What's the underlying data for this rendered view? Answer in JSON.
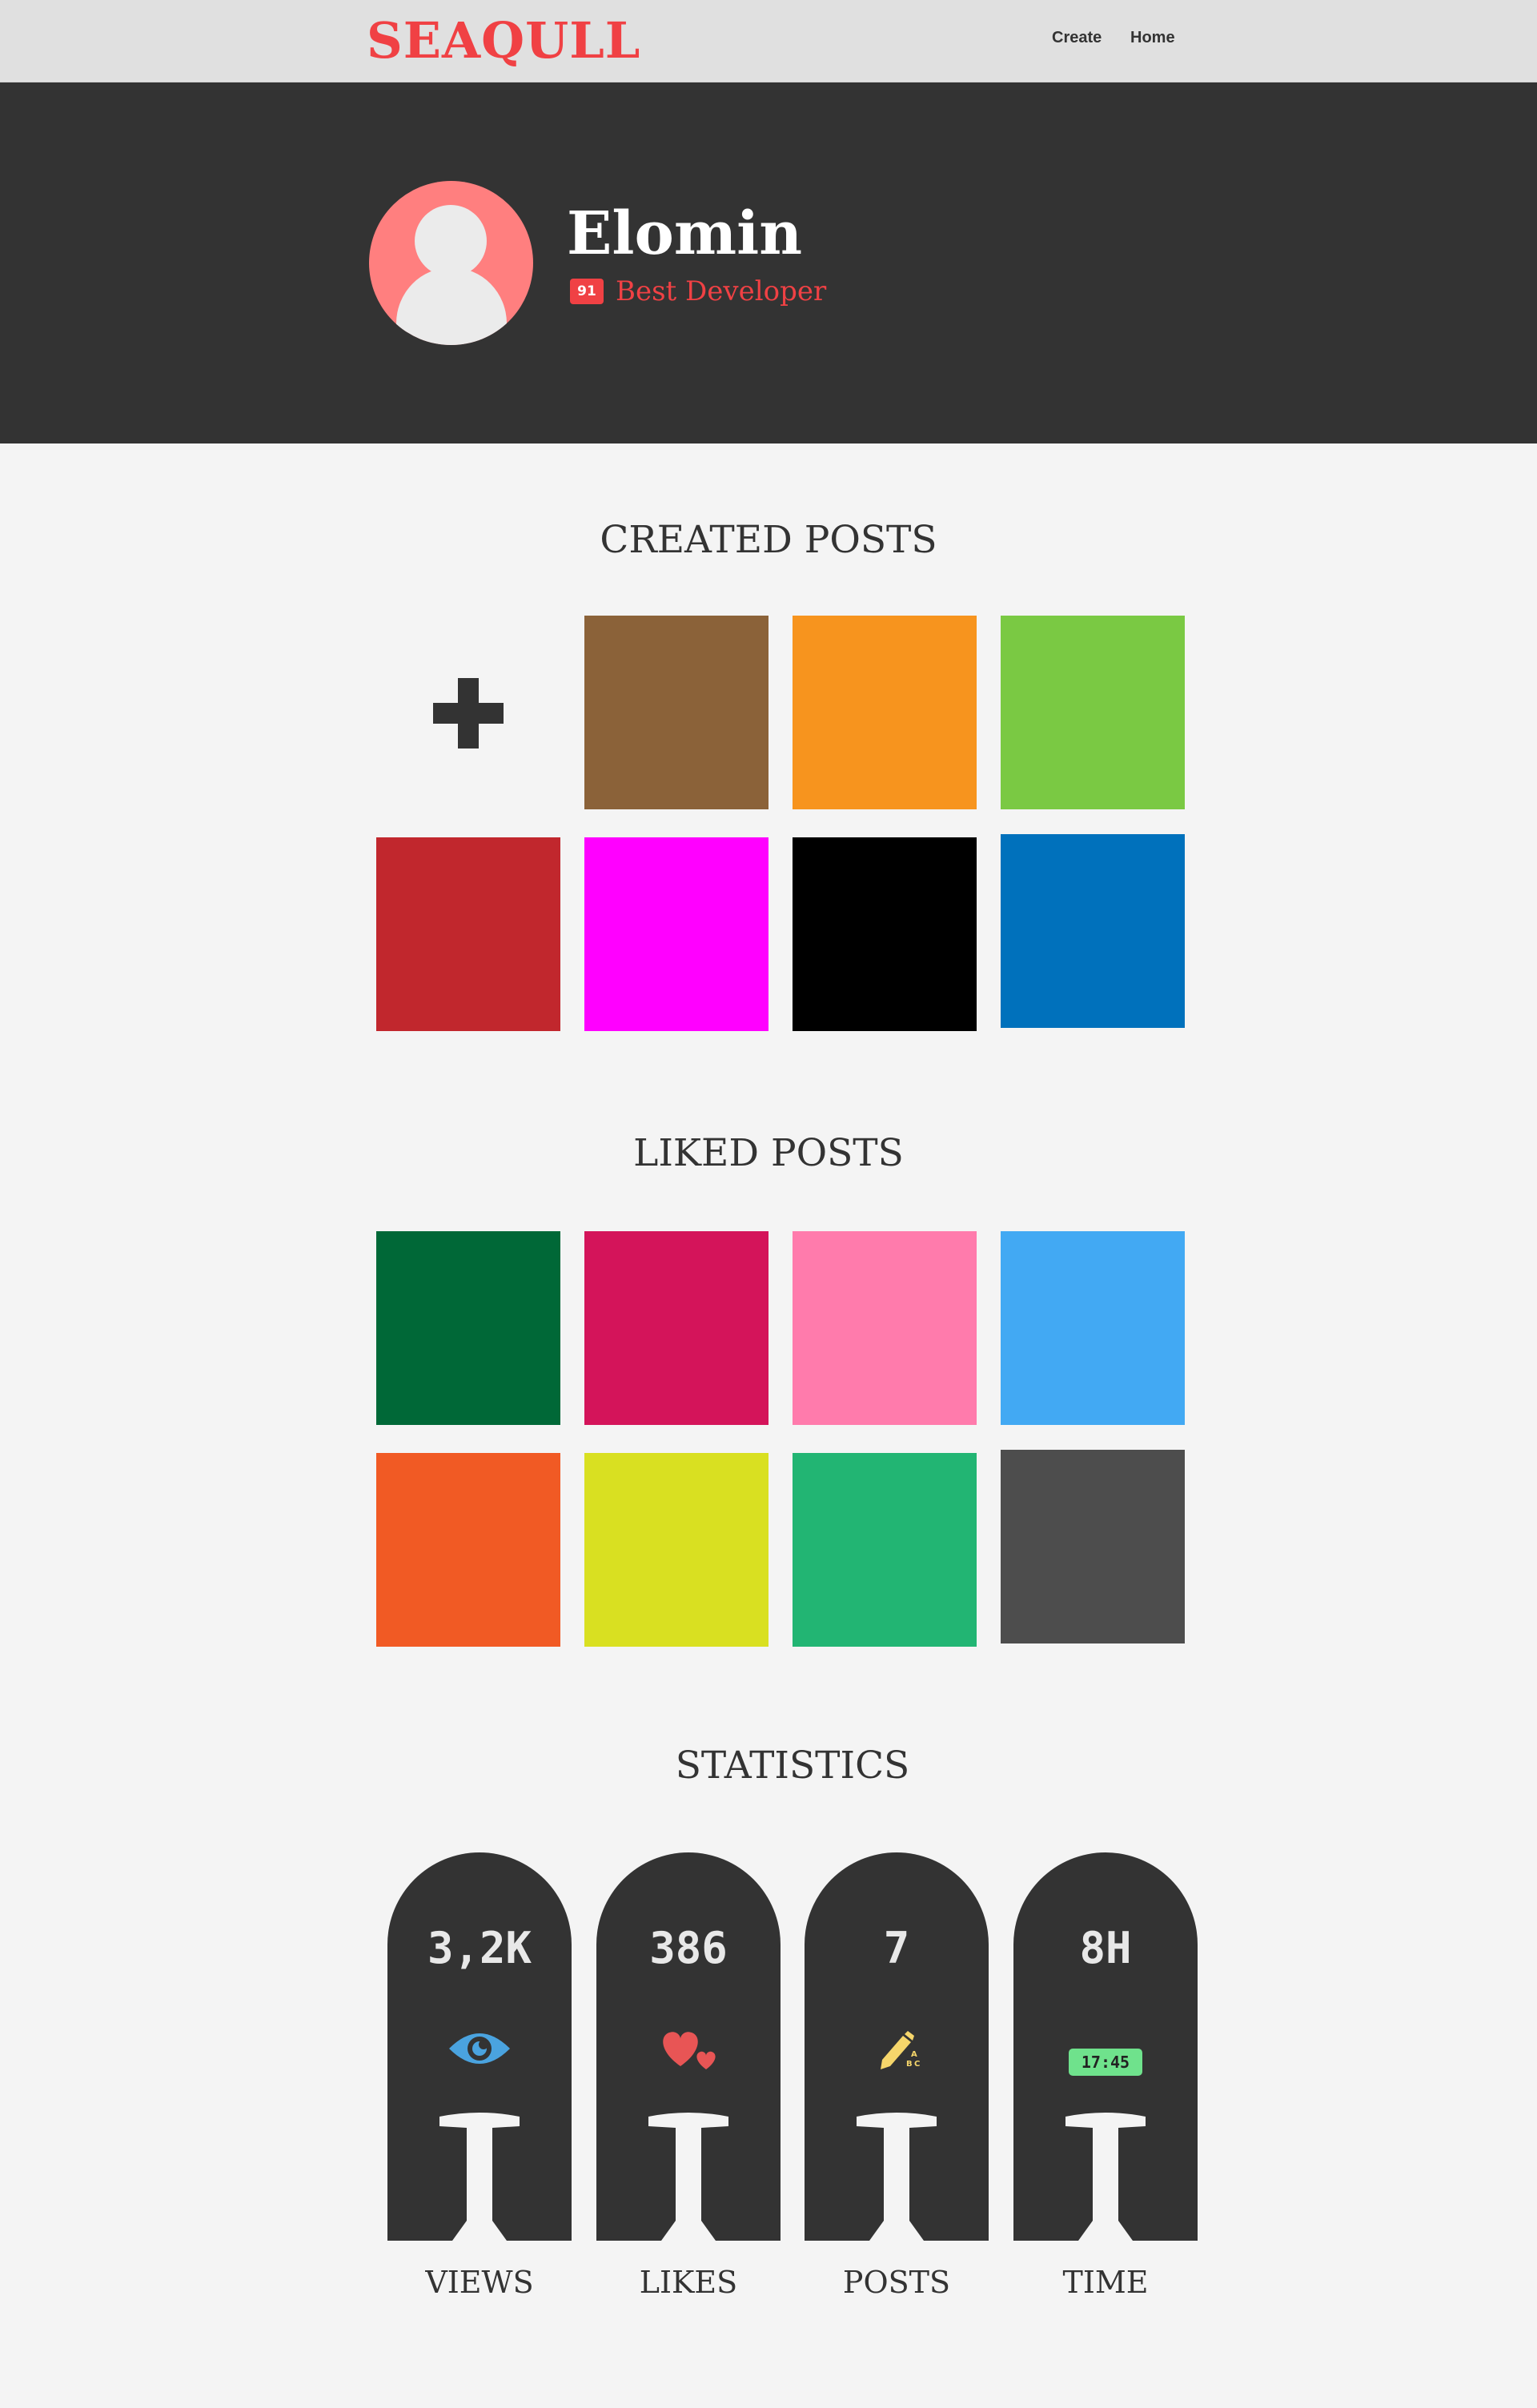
{
  "header": {
    "logo": "SEAQULL",
    "nav": {
      "create": "Create",
      "home": "Home"
    }
  },
  "profile": {
    "name": "Elomin",
    "rank_badge": "91",
    "rank_title": "Best Developer"
  },
  "created_posts": {
    "title": "CREATED POSTS",
    "add_icon": "plus-icon",
    "tiles": [
      "#8b6239",
      "#f7941e",
      "#7ac943",
      "#c1272d",
      "#ff00ff",
      "#000000",
      "#0071bc"
    ]
  },
  "liked_posts": {
    "title": "LIKED POSTS",
    "tiles": [
      "#006837",
      "#d4145a",
      "#ff7bac",
      "#42a9f3",
      "#f15a24",
      "#d9e021",
      "#22b573",
      "#4d4d4d"
    ]
  },
  "statistics": {
    "title": "STATISTICS",
    "cards": [
      {
        "value": "3,2K",
        "label": "VIEWS",
        "icon": "eye-icon",
        "icon_color": "#4aa3df"
      },
      {
        "value": "386",
        "label": "LIKES",
        "icon": "hearts-icon",
        "icon_color": "#e85555"
      },
      {
        "value": "7",
        "label": "POSTS",
        "icon": "pencil-abc-icon",
        "icon_color": "#f6d66b"
      },
      {
        "value": "8H",
        "label": "TIME",
        "icon": "clock-display-icon",
        "icon_color": "#6fe28c",
        "icon_text": "17:45"
      }
    ]
  },
  "colors": {
    "accent": "#f04144",
    "dark": "#333333",
    "background": "#f4f4f4",
    "topbar": "#e0e0e0"
  }
}
